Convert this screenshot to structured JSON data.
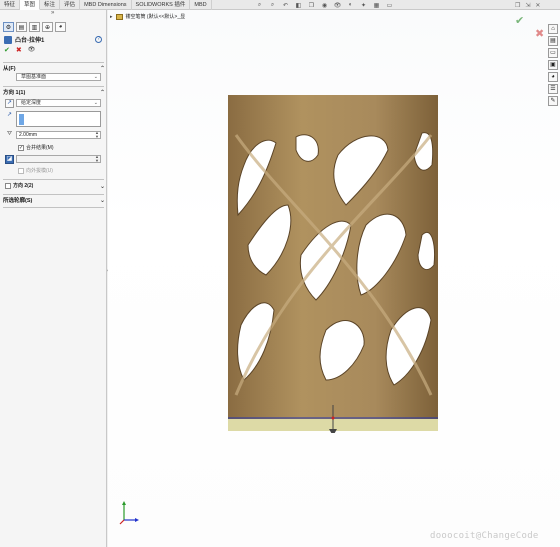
{
  "tabs": [
    "特征",
    "草图",
    "标注",
    "评估",
    "MBD Dimensions",
    "SOLIDWORKS 插件",
    "MBD"
  ],
  "active_tab_index": 1,
  "property_manager": {
    "expand_glyph": "»",
    "title": "凸台-拉伸1",
    "help": "?",
    "ok": "✔",
    "cancel": "✖",
    "preview": "👁",
    "from": {
      "label": "从(F)",
      "value": "草图基准面"
    },
    "direction1": {
      "label": "方向 1(1)",
      "end_condition": "给定深度",
      "depth": "2.00mm",
      "merge_result": "合并结果(M)",
      "merge_checked": true,
      "draft_outward": "向外拔模(U)",
      "draft_outward_checked": false
    },
    "direction2": {
      "label": "方向 2(2)"
    },
    "selected_contours": {
      "label": "所选轮廓(S)"
    }
  },
  "viewport": {
    "tree_label": "镂空笔筒  (默认<<默认>_显",
    "hud_icons": [
      "zoom-fit-icon",
      "zoom-area-icon",
      "previous-view-icon",
      "section-view-icon",
      "view-orientation-icon",
      "display-style-icon",
      "hide-show-icon",
      "edit-appearance-icon",
      "apply-scene-icon",
      "view-settings-icon",
      "display-icon"
    ],
    "window_controls": [
      "restore-icon",
      "split-icon",
      "close-icon"
    ]
  },
  "colors": {
    "model_body": "#a88a5c",
    "model_dark": "#6e5533",
    "model_light": "#c8ad80",
    "base_plane": "#dddaa6",
    "accent_blue": "#3b6db3"
  },
  "watermark": "dooocoit@ChangeCode"
}
